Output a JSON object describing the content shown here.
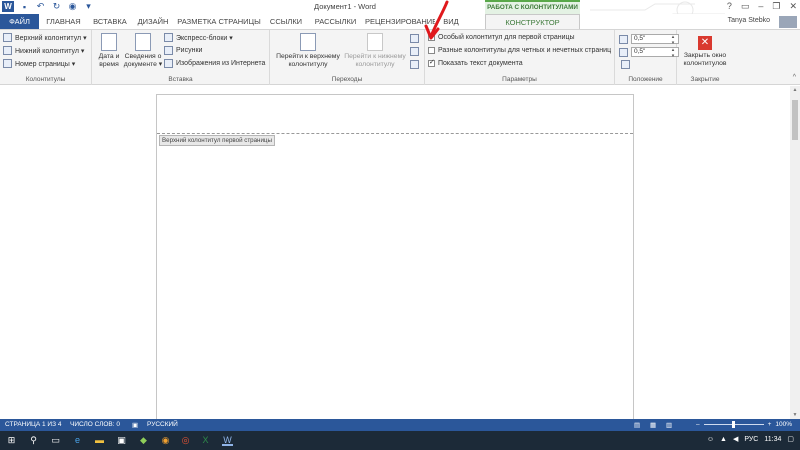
{
  "window": {
    "title": "Документ1 - Word",
    "context_tab_header": "РАБОТА С КОЛОНТИТУЛАМИ",
    "user_name": "Tanya Stebko"
  },
  "tabs": [
    {
      "label": "ФАЙЛ"
    },
    {
      "label": "ГЛАВНАЯ"
    },
    {
      "label": "ВСТАВКА"
    },
    {
      "label": "ДИЗАЙН"
    },
    {
      "label": "РАЗМЕТКА СТРАНИЦЫ"
    },
    {
      "label": "ССЫЛКИ"
    },
    {
      "label": "РАССЫЛКИ"
    },
    {
      "label": "РЕЦЕНЗИРОВАНИЕ"
    },
    {
      "label": "ВИД"
    },
    {
      "label": "КОНСТРУКТОР"
    }
  ],
  "ribbon": {
    "kolontituly": {
      "items": [
        "Верхний колонтитул ▾",
        "Нижний колонтитул ▾",
        "Номер страницы ▾"
      ],
      "label": "Колонтитулы"
    },
    "vstavka": {
      "date_btn": [
        "Дата и",
        "время"
      ],
      "docinfo_btn": [
        "Сведения о",
        "документе ▾"
      ],
      "items": [
        "Экспресс-блоки ▾",
        "Рисунки",
        "Изображения из Интернета"
      ],
      "label": "Вставка"
    },
    "perehody": {
      "to_header": [
        "Перейти к верхнему",
        "колонтитулу"
      ],
      "to_footer": [
        "Перейти к нижнему",
        "колонтитулу"
      ],
      "label": "Переходы"
    },
    "parametry": {
      "options": [
        {
          "label": "Особый колонтитул для первой страницы",
          "checked": false
        },
        {
          "label": "Разные колонтитулы для четных и нечетных страниц",
          "checked": false
        },
        {
          "label": "Показать текст документа",
          "checked": true
        }
      ],
      "label": "Параметры"
    },
    "polozhenie": {
      "header_pos": "0,5\"",
      "footer_pos": "0,5\"",
      "label": "Положение"
    },
    "zakrytie": {
      "close_btn": [
        "Закрыть окно",
        "колонтитулов"
      ],
      "label": "Закрытие"
    }
  },
  "document": {
    "header_tag": "Верхний колонтитул первой страницы"
  },
  "statusbar": {
    "page": "СТРАНИЦА 1 ИЗ 4",
    "words": "ЧИСЛО СЛОВ: 0",
    "language": "РУССКИЙ",
    "zoom_percent": 100
  },
  "taskbar": {
    "tray_lang": "РУС",
    "time": "11:34"
  },
  "colors": {
    "word_blue": "#2b579a",
    "context_green": "#59a84a",
    "annotation_red": "#e0181c"
  }
}
